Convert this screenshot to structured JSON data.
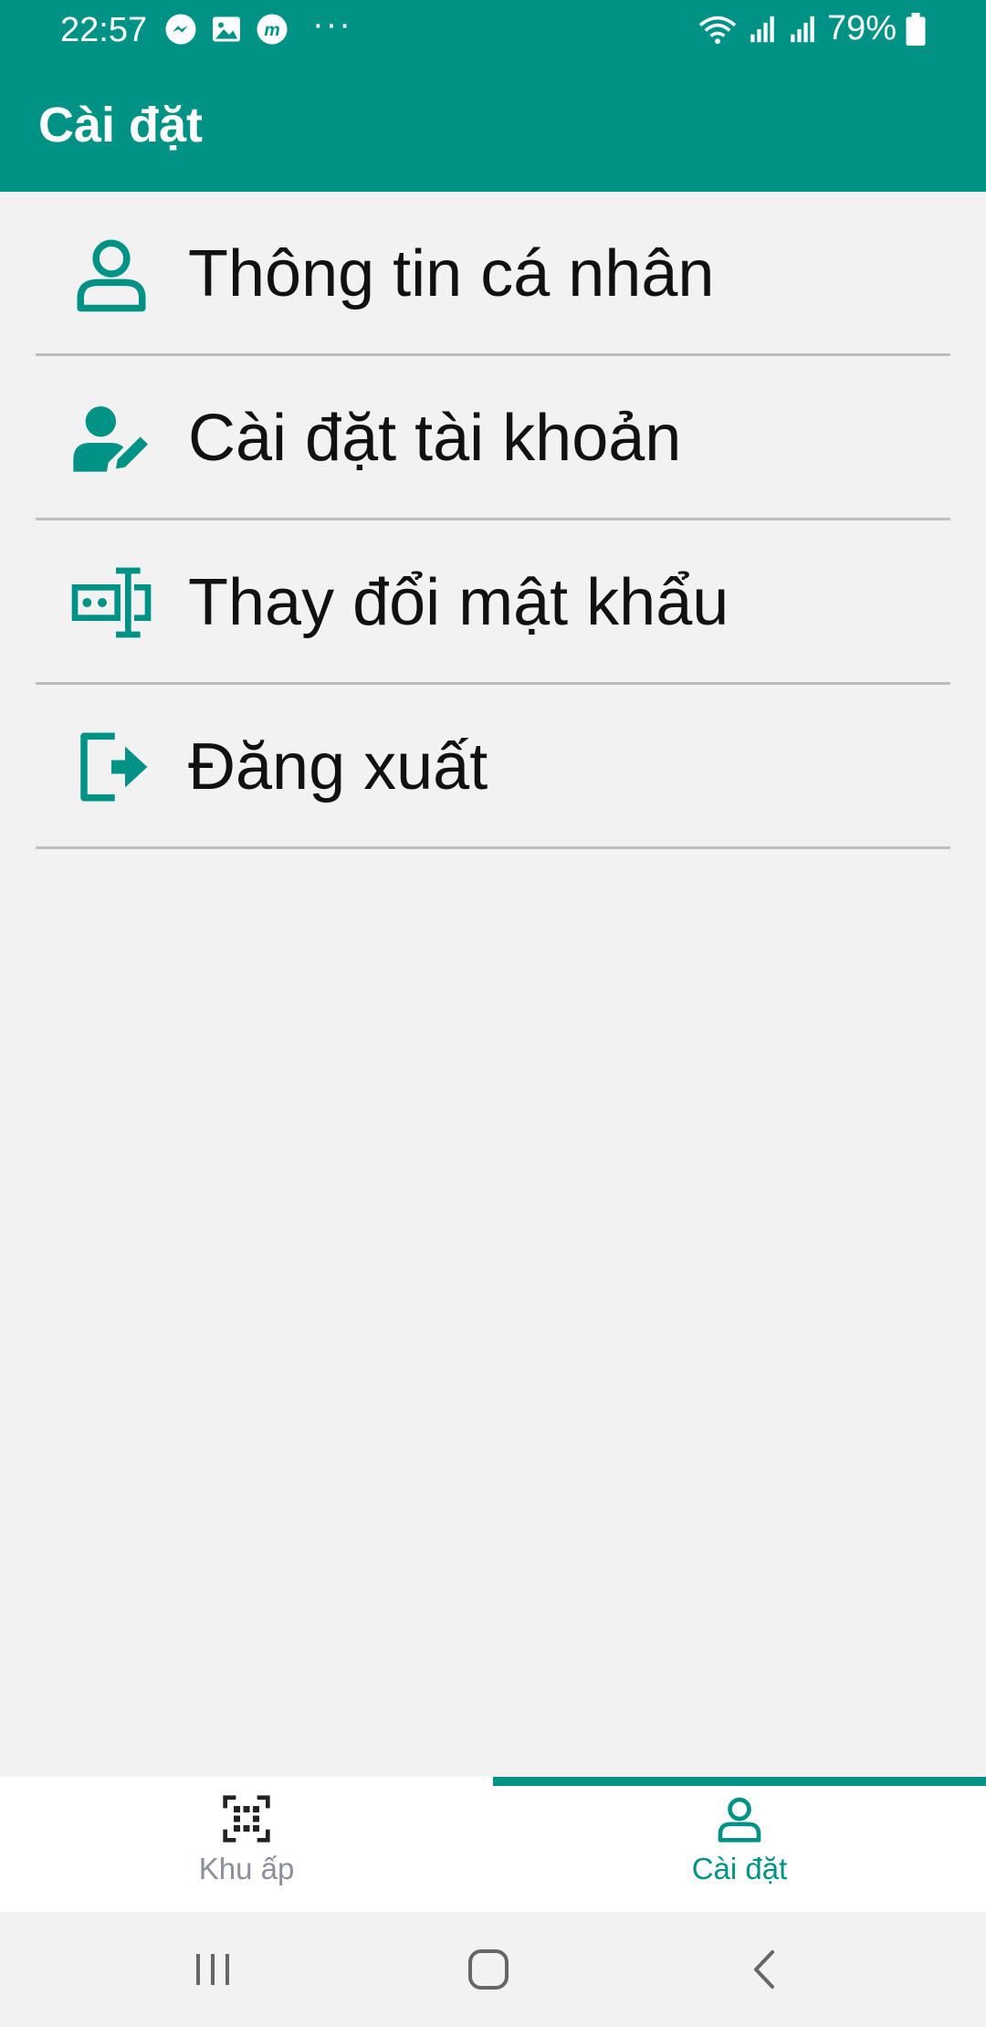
{
  "status_bar": {
    "time": "22:57",
    "battery": "79%",
    "more": "···",
    "left_icons": [
      "messenger-icon",
      "image-icon",
      "m-app-icon"
    ],
    "right_icons": [
      "wifi-icon",
      "signal-icon",
      "signal-icon",
      "battery-icon"
    ]
  },
  "header": {
    "title": "Cài đặt",
    "background": "#009385"
  },
  "menu": {
    "items": [
      {
        "label": "Thông tin cá nhân",
        "icon": "person-outline-icon"
      },
      {
        "label": "Cài đặt tài khoản",
        "icon": "user-edit-icon"
      },
      {
        "label": "Thay đổi mật khẩu",
        "icon": "password-field-icon"
      },
      {
        "label": "Đăng xuất",
        "icon": "logout-icon"
      }
    ],
    "icon_color": "#009385"
  },
  "bottom_nav": {
    "tabs": [
      {
        "label": "Khu ấp",
        "icon": "qr-scan-icon",
        "active": false
      },
      {
        "label": "Cài đặt",
        "icon": "person-outline-icon",
        "active": true
      }
    ],
    "active_color": "#009385",
    "inactive_color": "#8a8f99"
  },
  "system_nav": {
    "buttons": [
      "recents-icon",
      "home-icon",
      "back-icon"
    ]
  }
}
